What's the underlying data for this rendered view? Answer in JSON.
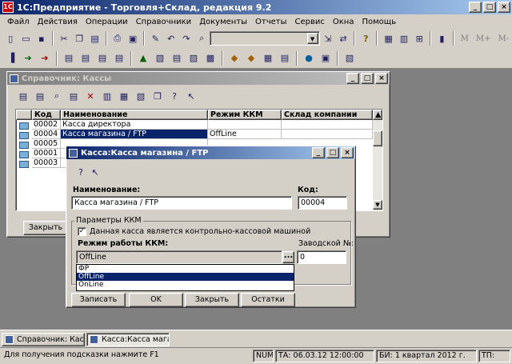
{
  "app": {
    "title": "1С:Предприятие - Торговля+Склад, редакция 9.2"
  },
  "menu": [
    "Файл",
    "Действия",
    "Операции",
    "Справочники",
    "Документы",
    "Отчеты",
    "Сервис",
    "Окна",
    "Помощь"
  ],
  "toolbar": {
    "m_label": "M",
    "m_plus_label": "M+",
    "m_minus_label": "M-"
  },
  "kassy_window": {
    "title": "Справочник: Кассы",
    "columns": [
      "Код",
      "Наименование",
      "Режим ККМ",
      "Склад компании"
    ],
    "rows": [
      {
        "code": "00002",
        "name": "Касса директора",
        "mode": "",
        "warehouse": ""
      },
      {
        "code": "00004",
        "name": "Касса магазина / FTP",
        "mode": "OffLine",
        "warehouse": ""
      },
      {
        "code": "00005",
        "name": "",
        "mode": "",
        "warehouse": ""
      },
      {
        "code": "00001",
        "name": "",
        "mode": "",
        "warehouse": ""
      },
      {
        "code": "00003",
        "name": "",
        "mode": "",
        "warehouse": ""
      }
    ],
    "close_button": "Закрыть"
  },
  "kassa_window": {
    "title": "Касса:Касса магазина / FTP",
    "name_label": "Наименование:",
    "name_value": "Касса магазина / FTP",
    "code_label": "Код:",
    "code_value": "00004",
    "group_label": "Параметры ККМ",
    "checkbox_label": "Данная касса является контрольно-кассовой машиной",
    "mode_label": "Режим работы ККМ:",
    "mode_value": "OffLine",
    "serial_label": "Заводской №:",
    "serial_value": "0",
    "dropdown_options": [
      "ФР",
      "OffLine",
      "OnLine"
    ],
    "dropdown_selected": "OffLine",
    "buttons": {
      "save": "Записать",
      "ok": "OK",
      "close": "Закрыть",
      "stock": "Остатки"
    }
  },
  "taskbar": [
    {
      "label": "Справочник: Кассы"
    },
    {
      "label": "Касса:Касса магаз..."
    }
  ],
  "status": {
    "hint": "Для получения подсказки нажмите F1",
    "num": "NUM",
    "ta": "ТА: 06.03.12  12:00:00",
    "bi": "БИ: 1 квартал 2012 г.",
    "tp": "ТП:"
  }
}
